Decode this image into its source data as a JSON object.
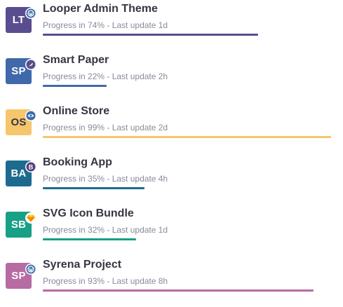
{
  "projects": [
    {
      "initials": "LT",
      "title": "Looper Admin Theme",
      "progress_text": "Progress in 74% - Last update 1d",
      "progress": 0.74,
      "color": "#5a4d8f",
      "bar_color": "#5a4d8f",
      "badge_icon": "wordpress-icon",
      "badge_color": "#3b6cae"
    },
    {
      "initials": "SP",
      "title": "Smart Paper",
      "progress_text": "Progress in 22% - Last update 2h",
      "progress": 0.22,
      "color": "#3f69aa",
      "bar_color": "#3f69aa",
      "badge_icon": "feather-icon",
      "badge_color": "#5a4d8f"
    },
    {
      "initials": "OS",
      "title": "Online Store",
      "progress_text": "Progress in 99% - Last update 2d",
      "progress": 0.99,
      "color": "#f5c66c",
      "text_color": "#363642",
      "bar_color": "#f5c66c",
      "badge_icon": "eye-icon",
      "badge_color": "#3b6cae"
    },
    {
      "initials": "BA",
      "title": "Booking App",
      "progress_text": "Progress in 35% - Last update 4h",
      "progress": 0.35,
      "color": "#1c6b8f",
      "bar_color": "#1c6b8f",
      "badge_icon": "bootstrap-icon",
      "badge_color": "#563d7c"
    },
    {
      "initials": "SB",
      "title": "SVG Icon Bundle",
      "progress_text": "Progress in 32% - Last update 1d",
      "progress": 0.32,
      "color": "#17a085",
      "bar_color": "#17a085",
      "badge_icon": "sketch-icon",
      "badge_color": "#f7b500"
    },
    {
      "initials": "SP",
      "title": "Syrena Project",
      "progress_text": "Progress in 93% - Last update 8h",
      "progress": 0.93,
      "color": "#b76ba3",
      "bar_color": "#b76ba3",
      "badge_icon": "wordpress-icon",
      "badge_color": "#3b6cae"
    }
  ]
}
